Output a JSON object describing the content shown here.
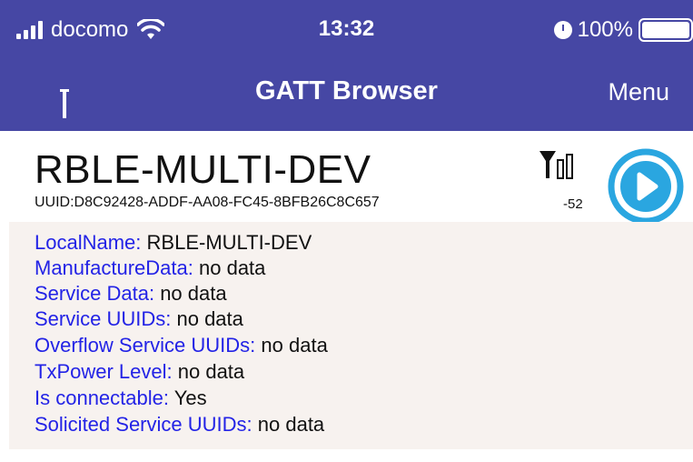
{
  "status_bar": {
    "carrier": "docomo",
    "time": "13:32",
    "battery_percent": "100%",
    "icons": [
      "signal-icon",
      "wifi-icon",
      "alarm-icon",
      "battery-icon"
    ]
  },
  "nav": {
    "title": "GATT Browser",
    "menu_label": "Menu",
    "left_icon": "antenna-back-icon",
    "bar_color": "#4647a4"
  },
  "device": {
    "name": "RBLE-MULTI-DEV",
    "uuid": "UUID:D8C92428-ADDF-AA08-FC45-8BFB26C8C657",
    "rssi": "-52",
    "signal_icon": "signal-strength-icon",
    "connect_icon": "play-circle-icon",
    "accent": "#2aa6e0"
  },
  "advertisement": [
    {
      "key": "LocalName:",
      "value": "RBLE-MULTI-DEV"
    },
    {
      "key": "ManufactureData:",
      "value": "no data"
    },
    {
      "key": "Service Data:",
      "value": "no data"
    },
    {
      "key": "Service UUIDs:",
      "value": "no data"
    },
    {
      "key": "Overflow Service UUIDs:",
      "value": "no data"
    },
    {
      "key": "TxPower Level:",
      "value": "no data"
    },
    {
      "key": "Is connectable:",
      "value": "Yes"
    },
    {
      "key": "Solicited Service UUIDs:",
      "value": "no data"
    }
  ]
}
